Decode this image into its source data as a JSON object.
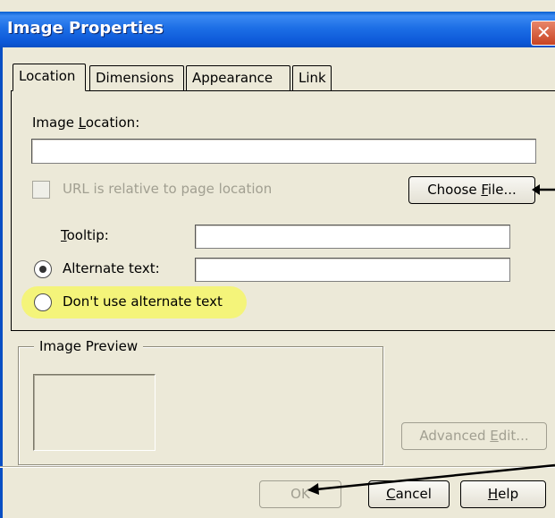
{
  "window": {
    "title": "Image Properties",
    "close_glyph": "✕"
  },
  "tabs": [
    {
      "label": "Location",
      "active": true
    },
    {
      "label": "Dimensions",
      "active": false
    },
    {
      "label": "Appearance",
      "active": false
    },
    {
      "label": "Link",
      "active": false
    }
  ],
  "location": {
    "image_location_label": {
      "pre": "Image ",
      "key": "L",
      "post": "ocation:"
    },
    "image_location_value": "",
    "relative_checkbox_label": "URL is relative to page location",
    "relative_checked": false,
    "choose_file": {
      "pre": "Choose ",
      "key": "F",
      "post": "ile..."
    },
    "tooltip_label": {
      "pre": "",
      "key": "T",
      "post": "ooltip:"
    },
    "tooltip_value": "",
    "alternate_text_label": "Alternate text:",
    "alternate_text_value": "",
    "alternate_selected": true,
    "no_alt_label": "Don't use alternate text"
  },
  "preview": {
    "legend": "Image Preview",
    "advanced_edit": {
      "pre": "Advanced ",
      "key": "E",
      "post": "dit..."
    }
  },
  "buttons": {
    "ok": "OK",
    "cancel": {
      "pre": "",
      "key": "C",
      "post": "ancel"
    },
    "help": {
      "pre": "",
      "key": "H",
      "post": "elp"
    }
  },
  "colors": {
    "titlebar": "#0a5fd0",
    "dialog": "#ece9d8",
    "highlight": "#f6f66a",
    "disabled_text": "#a19f91"
  },
  "icons": {
    "close": "close-icon",
    "annotation_arrows": "arrow-icon"
  }
}
